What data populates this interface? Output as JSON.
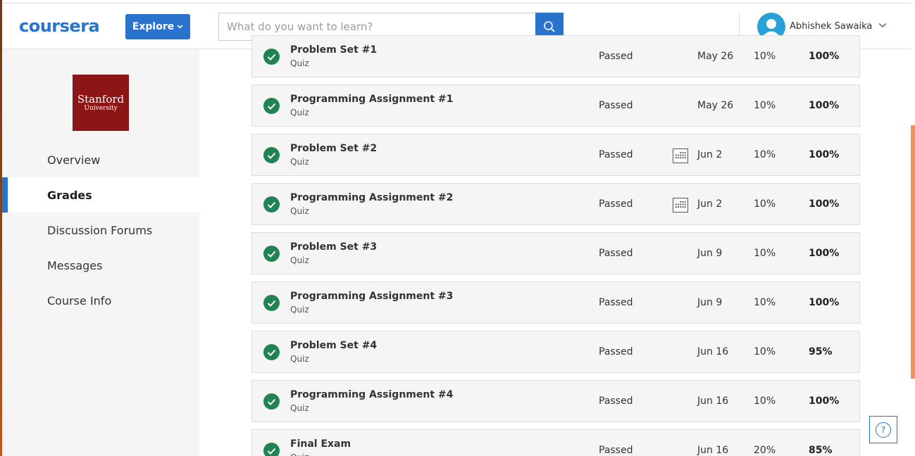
{
  "header": {
    "logo": "coursera",
    "explore_label": "Explore",
    "search_placeholder": "What do you want to learn?",
    "user_name": "Abhishek Sawaika"
  },
  "sidebar": {
    "university": {
      "line1": "Stanford",
      "line2": "University"
    },
    "items": [
      {
        "label": "Overview",
        "active": false
      },
      {
        "label": "Grades",
        "active": true
      },
      {
        "label": "Discussion Forums",
        "active": false
      },
      {
        "label": "Messages",
        "active": false
      },
      {
        "label": "Course Info",
        "active": false
      }
    ]
  },
  "grades": [
    {
      "title": "Problem Set #1",
      "type": "Quiz",
      "status": "Passed",
      "date": "May 26",
      "weight": "10%",
      "grade": "100%",
      "calendar": false
    },
    {
      "title": "Programming Assignment #1",
      "type": "Quiz",
      "status": "Passed",
      "date": "May 26",
      "weight": "10%",
      "grade": "100%",
      "calendar": false
    },
    {
      "title": "Problem Set #2",
      "type": "Quiz",
      "status": "Passed",
      "date": "Jun 2",
      "weight": "10%",
      "grade": "100%",
      "calendar": true
    },
    {
      "title": "Programming Assignment #2",
      "type": "Quiz",
      "status": "Passed",
      "date": "Jun 2",
      "weight": "10%",
      "grade": "100%",
      "calendar": true
    },
    {
      "title": "Problem Set #3",
      "type": "Quiz",
      "status": "Passed",
      "date": "Jun 9",
      "weight": "10%",
      "grade": "100%",
      "calendar": false
    },
    {
      "title": "Programming Assignment #3",
      "type": "Quiz",
      "status": "Passed",
      "date": "Jun 9",
      "weight": "10%",
      "grade": "100%",
      "calendar": false
    },
    {
      "title": "Problem Set #4",
      "type": "Quiz",
      "status": "Passed",
      "date": "Jun 16",
      "weight": "10%",
      "grade": "95%",
      "calendar": false
    },
    {
      "title": "Programming Assignment #4",
      "type": "Quiz",
      "status": "Passed",
      "date": "Jun 16",
      "weight": "10%",
      "grade": "100%",
      "calendar": false
    },
    {
      "title": "Final Exam",
      "type": "Quiz",
      "status": "Passed",
      "date": "Jun 16",
      "weight": "20%",
      "grade": "85%",
      "calendar": false
    }
  ],
  "help_label": "?",
  "colors": {
    "brand": "#2a73cc",
    "passed": "#1f8354",
    "stanford": "#8c1515"
  }
}
